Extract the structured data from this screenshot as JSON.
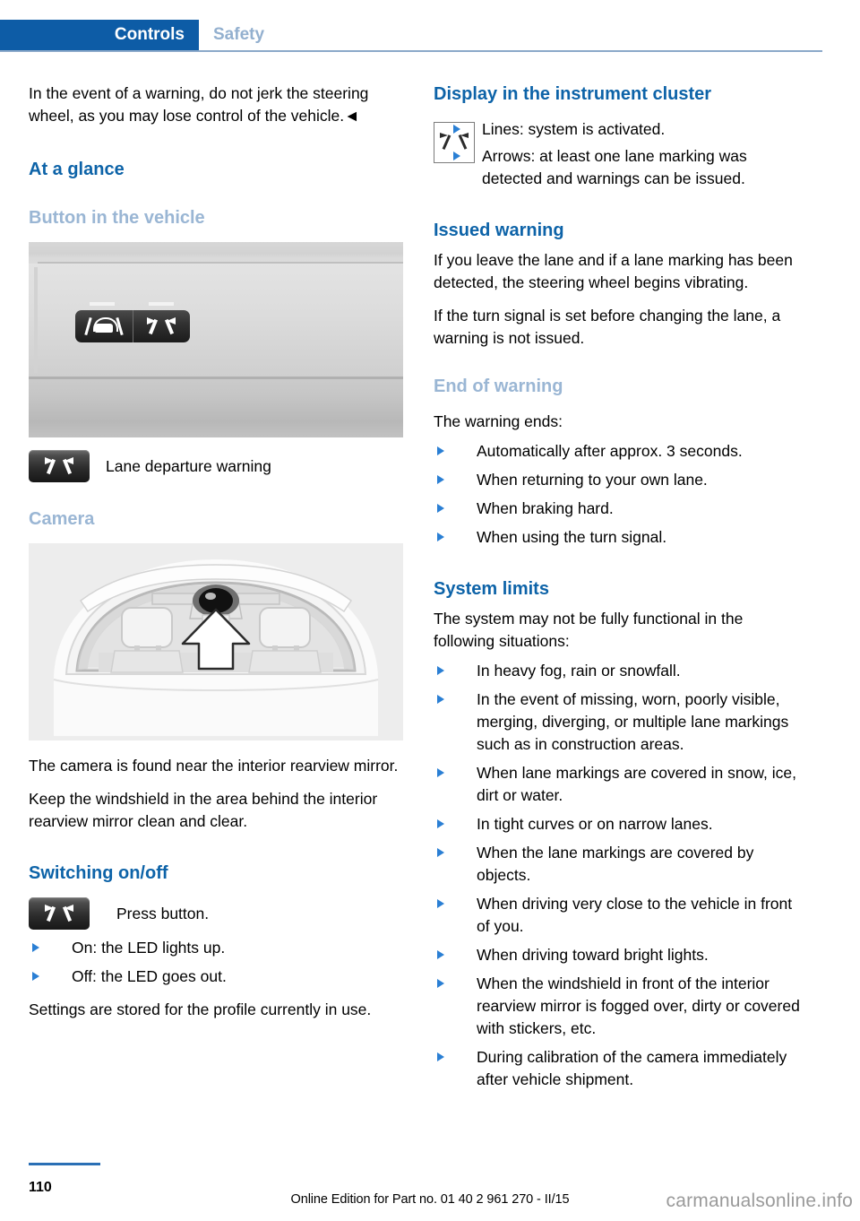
{
  "header": {
    "active_tab": "Controls",
    "inactive_tab": "Safety",
    "accent_color": "#0d5ca6",
    "inactive_color": "#93b0cf"
  },
  "left_column": {
    "intro_paragraph": "In the event of a warning, do not jerk the steering wheel, as you may lose control of the vehicle.◄",
    "at_a_glance_heading": "At a glance",
    "button_in_vehicle_heading": "Button in the vehicle",
    "lane_departure_caption": "Lane departure warning",
    "camera_heading": "Camera",
    "camera_paragraph_1": "The camera is found near the interior rearview mirror.",
    "camera_paragraph_2": "Keep the windshield in the area behind the interior rearview mirror clean and clear.",
    "switching_heading": "Switching on/off",
    "press_button_label": "Press button.",
    "switching_bullets": [
      "On: the LED lights up.",
      "Off: the LED goes out."
    ],
    "settings_paragraph": "Settings are stored for the profile currently in use."
  },
  "right_column": {
    "display_cluster_heading": "Display in the instrument cluster",
    "display_cluster_bullets": [
      "Lines: system is activated.",
      "Arrows: at least one lane marking was detected and warnings can be issued."
    ],
    "issued_warning_heading": "Issued warning",
    "issued_warning_paragraph_1": "If you leave the lane and if a lane marking has been detected, the steering wheel begins vibrating.",
    "issued_warning_paragraph_2": "If the turn signal is set before changing the lane, a warning is not issued.",
    "end_of_warning_heading": "End of warning",
    "end_of_warning_intro": "The warning ends:",
    "end_of_warning_bullets": [
      "Automatically after approx. 3 seconds.",
      "When returning to your own lane.",
      "When braking hard.",
      "When using the turn signal."
    ],
    "system_limits_heading": "System limits",
    "system_limits_intro": "The system may not be fully functional in the following situations:",
    "system_limits_bullets": [
      "In heavy fog, rain or snowfall.",
      "In the event of missing, worn, poorly visible, merging, diverging, or multiple lane markings such as in construction areas.",
      "When lane markings are covered in snow, ice, dirt or water.",
      "In tight curves or on narrow lanes.",
      "When the lane markings are covered by objects.",
      "When driving very close to the vehicle in front of you.",
      "When driving toward bright lights.",
      "When the windshield in front of the interior rearview mirror is fogged over, dirty or covered with stickers, etc.",
      "During calibration of the camera immediately after vehicle shipment."
    ]
  },
  "footer": {
    "page_number": "110",
    "edition_line": "Online Edition for Part no. 01 40 2 961 270 - II/15",
    "watermark": "carmanualsonline.info"
  },
  "icons": {
    "lane_departure_button": "lane-departure-warning-icon",
    "front_assist_button": "forward-collision-warning-icon",
    "cluster_display": "lane-departure-cluster-icon"
  }
}
